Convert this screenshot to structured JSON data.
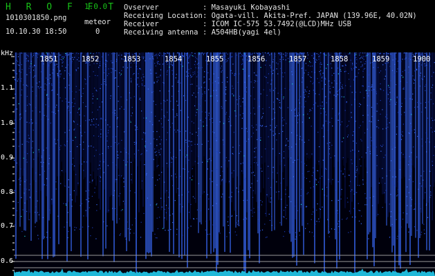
{
  "header": {
    "app_title": "H R O F F T",
    "version": "1.0.0",
    "filename": "1010301850.png",
    "datetime": "10.10.30 18:50",
    "meteor_label": "meteor",
    "meteor_count": "0"
  },
  "info": {
    "observer_label": "Ovserver",
    "observer_value": ": Masayuki Kobayashi",
    "location_label": "Receiving Location",
    "location_value": ": Ogata-vill. Akita-Pref. JAPAN (139.96E, 40.02N)",
    "receiver_label": "Receiver",
    "receiver_value": ": ICOM IC-575 53.7492(@LCD)MHz USB",
    "antenna_label": "Receiving antenna",
    "antenna_value": ": A504HB(yagi 4el)"
  },
  "axes": {
    "y_unit": "kHz",
    "y_ticks": [
      "1.1",
      "1.0",
      "0.9",
      "0.8",
      "0.7",
      "0.6"
    ],
    "time_ticks": [
      "1851",
      "1852",
      "1853",
      "1854",
      "1855",
      "1856",
      "1857",
      "1858",
      "1859",
      "1900"
    ]
  },
  "colors": {
    "signal_dim": "#0a1a6e",
    "signal_bright": "#3a6cff",
    "signal_peak": "#20d0d0",
    "header_green": "#18c218"
  }
}
